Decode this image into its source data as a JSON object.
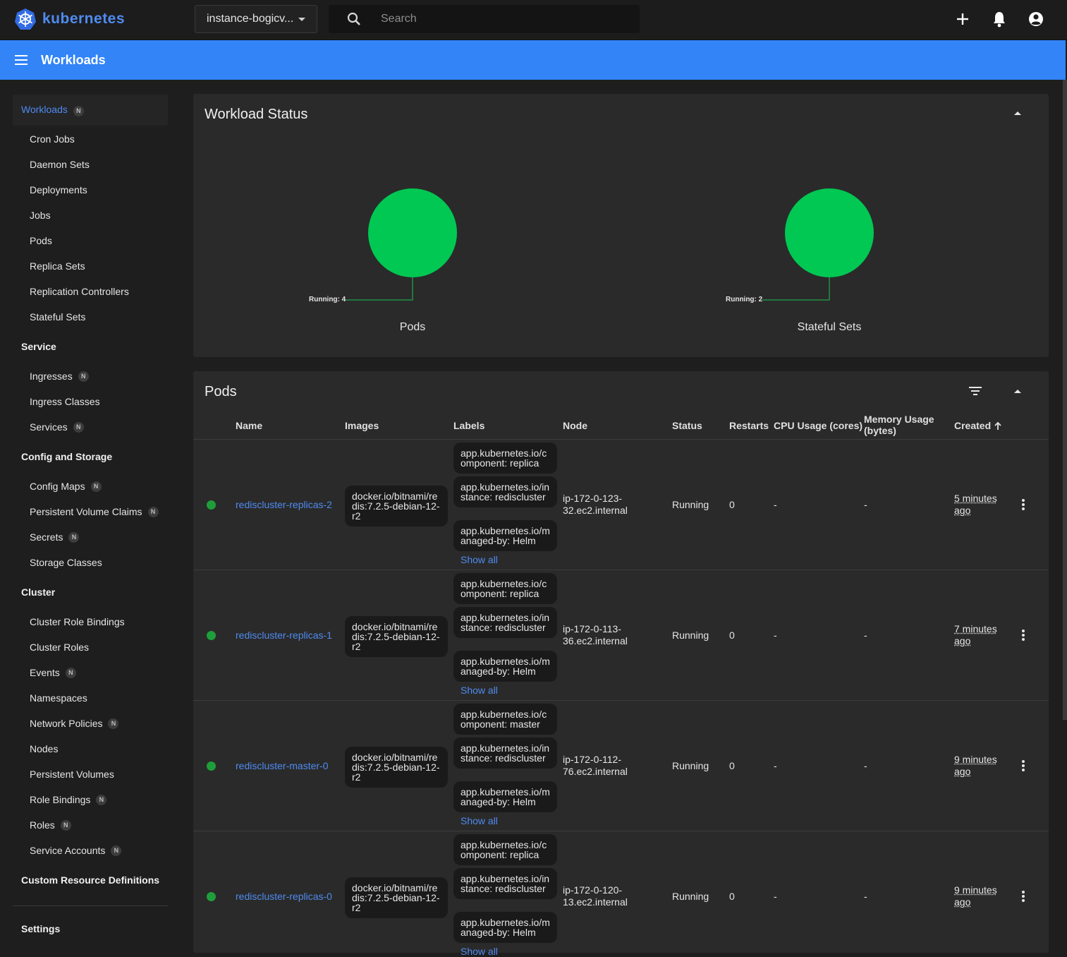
{
  "header": {
    "brand": "kubernetes",
    "namespace": "instance-bogicv...",
    "search_placeholder": "Search"
  },
  "appbar": {
    "title": "Workloads"
  },
  "sidebar": {
    "active": {
      "label": "Workloads",
      "badge": "N"
    },
    "workload_items": [
      {
        "label": "Cron Jobs"
      },
      {
        "label": "Daemon Sets"
      },
      {
        "label": "Deployments"
      },
      {
        "label": "Jobs"
      },
      {
        "label": "Pods"
      },
      {
        "label": "Replica Sets"
      },
      {
        "label": "Replication Controllers"
      },
      {
        "label": "Stateful Sets"
      }
    ],
    "service_head": "Service",
    "service_items": [
      {
        "label": "Ingresses",
        "badge": "N"
      },
      {
        "label": "Ingress Classes"
      },
      {
        "label": "Services",
        "badge": "N"
      }
    ],
    "config_head": "Config and Storage",
    "config_items": [
      {
        "label": "Config Maps",
        "badge": "N"
      },
      {
        "label": "Persistent Volume Claims",
        "badge": "N"
      },
      {
        "label": "Secrets",
        "badge": "N"
      },
      {
        "label": "Storage Classes"
      }
    ],
    "cluster_head": "Cluster",
    "cluster_items": [
      {
        "label": "Cluster Role Bindings"
      },
      {
        "label": "Cluster Roles"
      },
      {
        "label": "Events",
        "badge": "N"
      },
      {
        "label": "Namespaces"
      },
      {
        "label": "Network Policies",
        "badge": "N"
      },
      {
        "label": "Nodes"
      },
      {
        "label": "Persistent Volumes"
      },
      {
        "label": "Role Bindings",
        "badge": "N"
      },
      {
        "label": "Roles",
        "badge": "N"
      },
      {
        "label": "Service Accounts",
        "badge": "N"
      }
    ],
    "crd_head": "Custom Resource Definitions",
    "settings": "Settings"
  },
  "workload_status": {
    "title": "Workload Status",
    "charts": [
      {
        "name": "Pods",
        "label": "Running: 4",
        "running": 4,
        "color": "#00c853"
      },
      {
        "name": "Stateful Sets",
        "label": "Running: 2",
        "running": 2,
        "color": "#00c853"
      }
    ]
  },
  "pods": {
    "title": "Pods",
    "columns": {
      "name": "Name",
      "images": "Images",
      "labels": "Labels",
      "node": "Node",
      "status": "Status",
      "restarts": "Restarts",
      "cpu": "CPU Usage (cores)",
      "memory": "Memory Usage (bytes)",
      "created": "Created"
    },
    "show_all": "Show all",
    "rows": [
      {
        "name": "rediscluster-replicas-2",
        "image": "docker.io/bitnami/redis:7.2.5-debian-12-r2",
        "labels": [
          "app.kubernetes.io/component: replica",
          "app.kubernetes.io/instance: rediscluster",
          "app.kubernetes.io/managed-by: Helm"
        ],
        "node": "ip-172-0-123-32.ec2.internal",
        "status": "Running",
        "restarts": "0",
        "cpu": "-",
        "memory": "-",
        "created": "5 minutes ago"
      },
      {
        "name": "rediscluster-replicas-1",
        "image": "docker.io/bitnami/redis:7.2.5-debian-12-r2",
        "labels": [
          "app.kubernetes.io/component: replica",
          "app.kubernetes.io/instance: rediscluster",
          "app.kubernetes.io/managed-by: Helm"
        ],
        "node": "ip-172-0-113-36.ec2.internal",
        "status": "Running",
        "restarts": "0",
        "cpu": "-",
        "memory": "-",
        "created": "7 minutes ago"
      },
      {
        "name": "rediscluster-master-0",
        "image": "docker.io/bitnami/redis:7.2.5-debian-12-r2",
        "labels": [
          "app.kubernetes.io/component: master",
          "app.kubernetes.io/instance: rediscluster",
          "app.kubernetes.io/managed-by: Helm"
        ],
        "node": "ip-172-0-112-76.ec2.internal",
        "status": "Running",
        "restarts": "0",
        "cpu": "-",
        "memory": "-",
        "created": "9 minutes ago"
      },
      {
        "name": "rediscluster-replicas-0",
        "image": "docker.io/bitnami/redis:7.2.5-debian-12-r2",
        "labels": [
          "app.kubernetes.io/component: replica",
          "app.kubernetes.io/instance: rediscluster",
          "app.kubernetes.io/managed-by: Helm"
        ],
        "node": "ip-172-0-120-13.ec2.internal",
        "status": "Running",
        "restarts": "0",
        "cpu": "-",
        "memory": "-",
        "created": "9 minutes ago"
      }
    ]
  }
}
